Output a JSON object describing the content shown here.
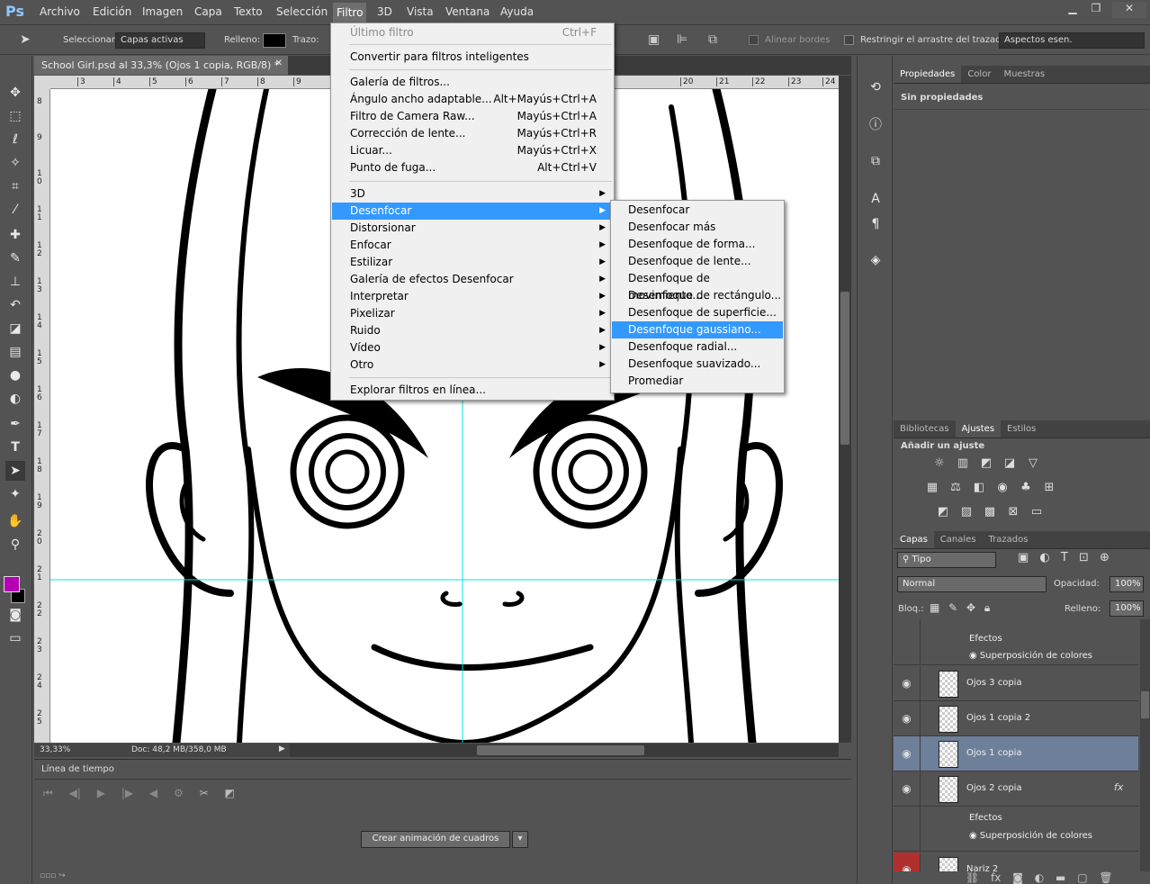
{
  "app": {
    "logo": "Ps"
  },
  "menubar": {
    "items": [
      "Archivo",
      "Edición",
      "Imagen",
      "Capa",
      "Texto",
      "Selección",
      "Filtro",
      "3D",
      "Vista",
      "Ventana",
      "Ayuda"
    ],
    "active": "Filtro"
  },
  "options": {
    "select_label": "Seleccionar:",
    "select_value": "Capas activas",
    "fill_label": "Relleno:",
    "stroke_label": "Trazo:",
    "align_edges": "Alinear bordes",
    "constrain_path": "Restringir el arrastre del trazado",
    "workspace": "Aspectos esen."
  },
  "document": {
    "tab_title": "School Girl.psd al 33,3% (Ojos 1 copia, RGB/8) *",
    "zoom": "33,33%",
    "doc_info": "Doc: 48,2 MB/358,0 MB",
    "ruler_top": [
      "3",
      "4",
      "5",
      "6",
      "7",
      "8",
      "9",
      "20",
      "21",
      "22",
      "23",
      "24"
    ],
    "ruler_left": [
      "8",
      "9",
      "10",
      "11",
      "12",
      "13",
      "14",
      "15",
      "16",
      "17",
      "18",
      "19",
      "20",
      "21",
      "22",
      "23",
      "24",
      "25"
    ]
  },
  "filter_menu": {
    "last_filter": "Último filtro",
    "last_filter_shortcut": "Ctrl+F",
    "convert_smart": "Convertir para filtros inteligentes",
    "group1": [
      {
        "label": "Galería de filtros...",
        "shortcut": ""
      },
      {
        "label": "Ángulo ancho adaptable...",
        "shortcut": "Alt+Mayús+Ctrl+A"
      },
      {
        "label": "Filtro de Camera Raw...",
        "shortcut": "Mayús+Ctrl+A"
      },
      {
        "label": "Corrección de lente...",
        "shortcut": "Mayús+Ctrl+R"
      },
      {
        "label": "Licuar...",
        "shortcut": "Mayús+Ctrl+X"
      },
      {
        "label": "Punto de fuga...",
        "shortcut": "Alt+Ctrl+V"
      }
    ],
    "group2": [
      "3D",
      "Desenfocar",
      "Distorsionar",
      "Enfocar",
      "Estilizar",
      "Galería de efectos Desenfocar",
      "Interpretar",
      "Pixelizar",
      "Ruido",
      "Vídeo",
      "Otro"
    ],
    "highlighted": "Desenfocar",
    "browse_online": "Explorar filtros en línea..."
  },
  "blur_submenu": {
    "items": [
      "Desenfocar",
      "Desenfocar más",
      "Desenfoque de forma...",
      "Desenfoque de lente...",
      "Desenfoque de movimiento...",
      "Desenfoque de rectángulo...",
      "Desenfoque de superficie...",
      "Desenfoque gaussiano...",
      "Desenfoque radial...",
      "Desenfoque suavizado...",
      "Promediar"
    ],
    "highlighted": "Desenfoque gaussiano..."
  },
  "timeline": {
    "title": "Línea de tiempo",
    "create_button": "Crear animación de cuadros"
  },
  "properties_panel": {
    "tabs": [
      "Propiedades",
      "Color",
      "Muestras"
    ],
    "active_tab": "Propiedades",
    "content": "Sin propiedades"
  },
  "adjustments_panel": {
    "tabs": [
      "Bibliotecas",
      "Ajustes",
      "Estilos"
    ],
    "active_tab": "Ajustes",
    "title": "Añadir un ajuste"
  },
  "layers_panel": {
    "tabs": [
      "Capas",
      "Canales",
      "Trazados"
    ],
    "active_tab": "Capas",
    "filter_kind": "Tipo",
    "blend_mode": "Normal",
    "opacity_label": "Opacidad:",
    "opacity": "100%",
    "lock_label": "Bloq.:",
    "fill_label": "Relleno:",
    "fill": "100%",
    "effects_label": "Efectos",
    "color_overlay": "Superposición de colores",
    "fx": "fx",
    "layers": [
      {
        "name": "Ojos 3 copia"
      },
      {
        "name": "Ojos 1 copia 2"
      },
      {
        "name": "Ojos 1 copia",
        "selected": true
      },
      {
        "name": "Ojos 2 copia"
      },
      {
        "name": "Nariz 2"
      }
    ]
  },
  "colors": {
    "foreground": "#b400b4",
    "background": "#000000",
    "highlight": "#3399ff",
    "guide": "#00e5e5"
  }
}
